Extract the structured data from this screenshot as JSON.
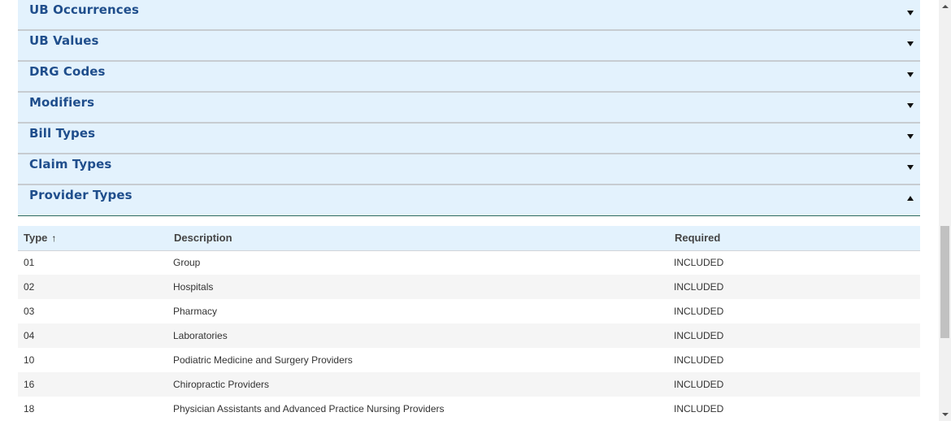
{
  "accordion": [
    {
      "title": "UB Occurrences",
      "state": "collapsed"
    },
    {
      "title": "UB Values",
      "state": "collapsed"
    },
    {
      "title": "DRG Codes",
      "state": "collapsed"
    },
    {
      "title": "Modifiers",
      "state": "collapsed"
    },
    {
      "title": "Bill Types",
      "state": "collapsed"
    },
    {
      "title": "Claim Types",
      "state": "collapsed"
    },
    {
      "title": "Provider Types",
      "state": "expanded"
    }
  ],
  "table": {
    "headers": {
      "type": "Type",
      "description": "Description",
      "required": "Required"
    },
    "sort_indicator": "↑",
    "rows": [
      {
        "type": "01",
        "description": "Group",
        "required": "INCLUDED"
      },
      {
        "type": "02",
        "description": "Hospitals",
        "required": "INCLUDED"
      },
      {
        "type": "03",
        "description": "Pharmacy",
        "required": "INCLUDED"
      },
      {
        "type": "04",
        "description": "Laboratories",
        "required": "INCLUDED"
      },
      {
        "type": "10",
        "description": "Podiatric Medicine and Surgery Providers",
        "required": "INCLUDED"
      },
      {
        "type": "16",
        "description": "Chiropractic Providers",
        "required": "INCLUDED"
      },
      {
        "type": "18",
        "description": "Physician Assistants and Advanced Practice Nursing Providers",
        "required": "INCLUDED"
      }
    ]
  },
  "colors": {
    "header_bg": "#e3f2fd",
    "title_color": "#1f4e8c",
    "row_alt_bg": "#f5f5f5"
  },
  "icons": {
    "collapsed": "chevron-down-icon",
    "expanded": "chevron-up-icon",
    "sort": "sort-ascending-icon"
  }
}
